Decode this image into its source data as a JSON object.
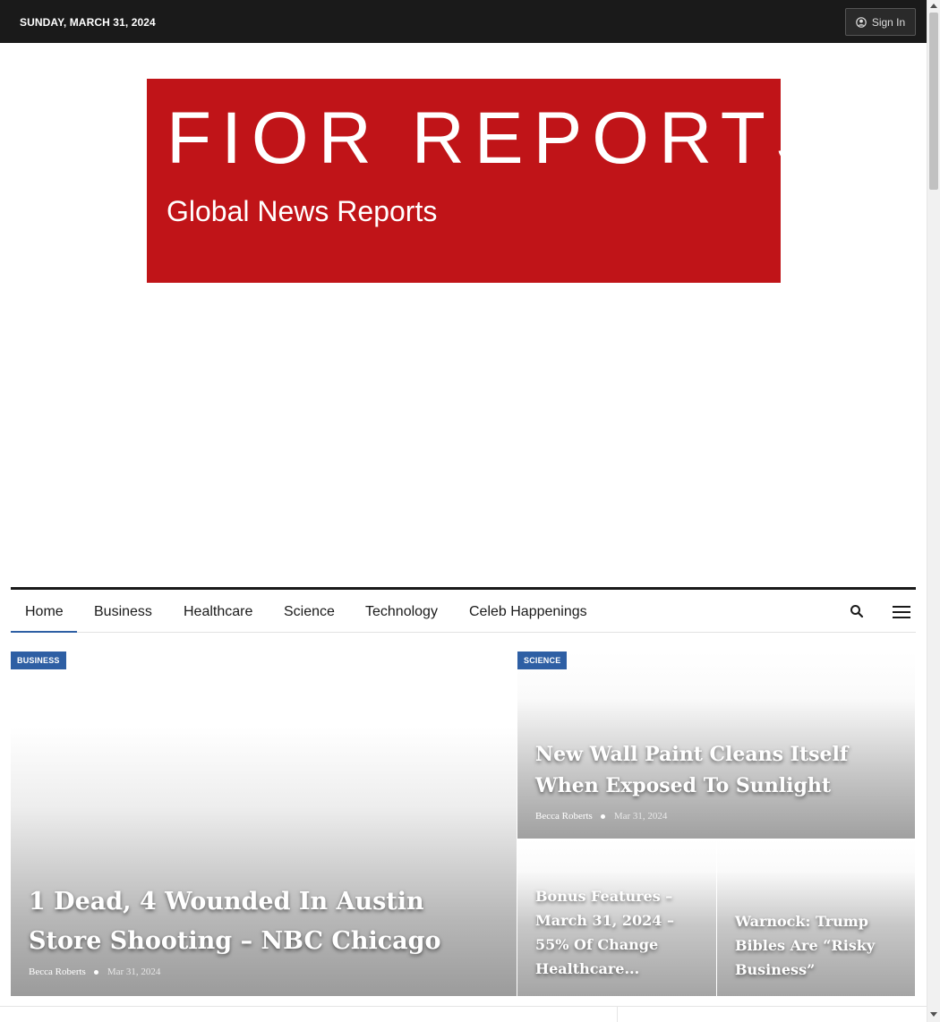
{
  "topbar": {
    "date": "SUNDAY, MARCH 31, 2024",
    "signin_label": "Sign In",
    "signin_icon": "user-circle-icon"
  },
  "banner": {
    "title": "FIOR REPORTS",
    "tagline": "Global News Reports",
    "color": "#c01418"
  },
  "nav": {
    "items": [
      {
        "label": "Home",
        "active": true
      },
      {
        "label": "Business"
      },
      {
        "label": "Healthcare"
      },
      {
        "label": "Science"
      },
      {
        "label": "Technology"
      },
      {
        "label": "Celeb Happenings"
      }
    ],
    "search_icon": "search-icon",
    "menu_icon": "hamburger-menu-icon",
    "accent": "#2e5fa4"
  },
  "featured": {
    "main": {
      "category": "BUSINESS",
      "title": "1 Dead, 4 Wounded In Austin Store Shooting – NBC Chicago",
      "author": "Becca Roberts",
      "date": "Mar 31, 2024"
    },
    "top_right": {
      "category": "SCIENCE",
      "title": "New Wall Paint Cleans Itself When Exposed To Sunlight",
      "author": "Becca Roberts",
      "date": "Mar 31, 2024"
    },
    "small": [
      {
        "title": "Bonus Features – March 31, 2024 – 55% Of Change Healthcare..."
      },
      {
        "title": "Warnock: Trump Bibles Are “Risky Business”"
      }
    ]
  }
}
